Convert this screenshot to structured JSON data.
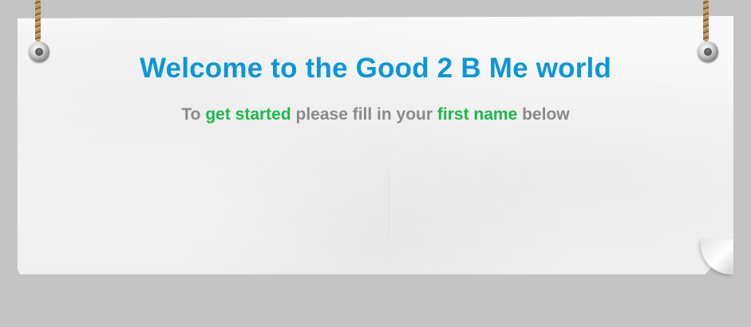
{
  "welcome": {
    "title": "Welcome to the Good 2 B Me world"
  },
  "instructions": {
    "part1": "To ",
    "highlight1": "get started",
    "part2": " please fill in your ",
    "highlight2": "first name",
    "part3": " below"
  },
  "colors": {
    "title": "#0b97d7",
    "highlight": "#1db84a",
    "body_text": "#8a8a8a",
    "background": "#c4c4c4"
  },
  "icons": {
    "left_hanger": "rope-grommet-icon",
    "right_hanger": "rope-grommet-icon"
  }
}
